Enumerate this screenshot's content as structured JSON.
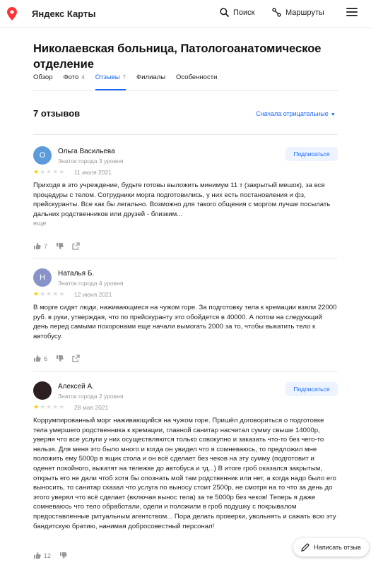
{
  "header": {
    "logo_text": "Яндекс Карты",
    "search_label": "Поиск",
    "routes_label": "Маршруты",
    "brand_color": "#f33",
    "menu_icon": "hamburger-menu-icon"
  },
  "org": {
    "title": "Николаевская больница, Патологоанатомическое отделение"
  },
  "tabs": [
    {
      "label": "Обзор",
      "count": ""
    },
    {
      "label": "Фото",
      "count": "4"
    },
    {
      "label": "Отзывы",
      "count": "7",
      "active": true
    },
    {
      "label": "Филиалы",
      "count": ""
    },
    {
      "label": "Особенности",
      "count": ""
    }
  ],
  "reviews_header": {
    "count_text": "7 отзывов",
    "sort_label": "Сначала отрицательные"
  },
  "reviews": [
    {
      "avatar_letter": "О",
      "avatar_color": "#5b9bd9",
      "author": "Ольга Васильева",
      "level": "Знаток города 3 уровня",
      "subscribe_label": "Подписаться",
      "rating": 1,
      "date": "11 июля 2021",
      "text": "Приходя в это учреждение, будьте готовы выложить минимум 11 т (закрытый мешок), за все процедуры с телом. Сотрудники морга подготовились, у них есть постановления и фз, прейскуранты. Все как бы легально. Возможно для такого общения с моргом лучше посылать дальних родственников или друзей - близким...",
      "more_label": "еще",
      "likes": "7"
    },
    {
      "avatar_letter": "Н",
      "avatar_color": "#8a93c9",
      "author": "Наталья Б.",
      "level": "Знаток города 4 уровня",
      "subscribe_label": "",
      "rating": 1,
      "date": "12 июня 2021",
      "text": "В морге сидят люди, наживающиеся на чужом горе. За подготовку тела к кремации взяли 22000 руб. в руки, утверждая, что по прейскуранту это обойдется в 40000. А потом на следующий день перед самыми похоронами еще начали вымогать 2000 за то, чтобы выкатить тело к автобусу.",
      "more_label": "",
      "likes": "6"
    },
    {
      "avatar_letter": "",
      "avatar_color": "#2b1f1f",
      "author": "Алексей А.",
      "level": "Знаток города 2 уровня",
      "subscribe_label": "Подписаться",
      "rating": 1,
      "date": "28 мая 2021",
      "text": "Коррумпированный морг наживающийся на чужом горе. Пришёл договориться о подготовке тела умершего родственника к кремации, главной санитар насчитал сумму свыше 14000р, уверяя что все услуги у них осуществляются только совокупно и заказать что-то без чего-то нельзя. Для меня это было много и когда он увидел что я сомневаюсь, то предложил мне положить ему 5000р в ящик стола и он всё сделает без чеков на эту сумму (подготовит и оденет покойного, выкатят на тележке до автобуса и тд...) В итоге гроб оказался закрытым, открыть его не дали чтоб хотя бы опознать мой там родственник или нет, а когда надо было его выносить, то санитар сказал что услуга по выносу стоит 2500р, не смотря на то что за день до этого уверял что всё сделает (включая вынос тела) за те 5000р без чеков! Теперь я даже сомневаюсь что тело обработали, одели и положили в гроб подушку с покрывалом предоставленные ритуальным агентством... Пора делать проверки, увольнять и сажать всю эту бандитскую братию, нанимая добросовестный персонал!",
      "more_label": "",
      "likes": "12"
    }
  ],
  "write_review": {
    "label": "Написать отзыв",
    "icon": "pencil-icon"
  },
  "colors": {
    "accent": "#1966ff",
    "star": "#fc0",
    "star_off": "#ddd"
  }
}
